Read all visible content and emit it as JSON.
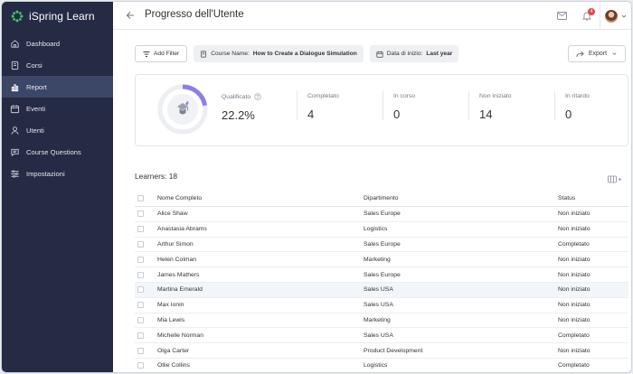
{
  "app": {
    "name": "iSpring Learn"
  },
  "sidebar": {
    "items": [
      {
        "label": "Dashboard",
        "icon": "home-icon"
      },
      {
        "label": "Corsi",
        "icon": "course-icon"
      },
      {
        "label": "Report",
        "icon": "chart-icon",
        "active": true
      },
      {
        "label": "Eventi",
        "icon": "calendar-icon"
      },
      {
        "label": "Utenti",
        "icon": "user-icon"
      },
      {
        "label": "Course Questions",
        "icon": "chat-icon"
      },
      {
        "label": "Impostazioni",
        "icon": "sliders-icon"
      }
    ]
  },
  "header": {
    "title": "Progresso dell'Utente",
    "notification_count": "4"
  },
  "filters": {
    "add_label": "Add Filter",
    "course_key": "Course Name:",
    "course_value": "How to Create a Dialogue Simulation",
    "date_key": "Data di inizio:",
    "date_value": "Last year"
  },
  "export": {
    "label": "Export"
  },
  "stats": {
    "qualified_label": "Qualificato",
    "qualified_value": "22.2%",
    "qualified_fraction": 0.222,
    "completed_label": "Completato",
    "completed_value": "4",
    "in_progress_label": "In corso",
    "in_progress_value": "0",
    "not_started_label": "Non iniziato",
    "not_started_value": "14",
    "late_label": "In ritardo",
    "late_value": "0"
  },
  "table": {
    "learners_label": "Learners: 18",
    "columns": [
      "Nome Completo",
      "Dipartimento",
      "Status"
    ],
    "rows": [
      {
        "name": "Alice Shaw",
        "dept": "Sales Europe",
        "status": "Non iniziato"
      },
      {
        "name": "Anastasia Abrams",
        "dept": "Logistics",
        "status": "Non iniziato"
      },
      {
        "name": "Arthur Simon",
        "dept": "Sales Europe",
        "status": "Completato"
      },
      {
        "name": "Helen Colman",
        "dept": "Marketing",
        "status": "Non iniziato"
      },
      {
        "name": "James Mathers",
        "dept": "Sales Europe",
        "status": "Non iniziato"
      },
      {
        "name": "Martina Emerald",
        "dept": "Sales USA",
        "status": "Non iniziato"
      },
      {
        "name": "Max Ionin",
        "dept": "Sales USA",
        "status": "Non iniziato"
      },
      {
        "name": "Mia Lewis",
        "dept": "Marketing",
        "status": "Non iniziato"
      },
      {
        "name": "Michelle Norman",
        "dept": "Sales USA",
        "status": "Completato"
      },
      {
        "name": "Olga Carter",
        "dept": "Product Development",
        "status": "Non iniziato"
      },
      {
        "name": "Ollie Collins",
        "dept": "Logistics",
        "status": "Completato"
      }
    ]
  },
  "colors": {
    "sidebar": "#252a45",
    "active": "#3c4666",
    "accent": "#8f7de8",
    "brand_green": "#41c36a"
  }
}
